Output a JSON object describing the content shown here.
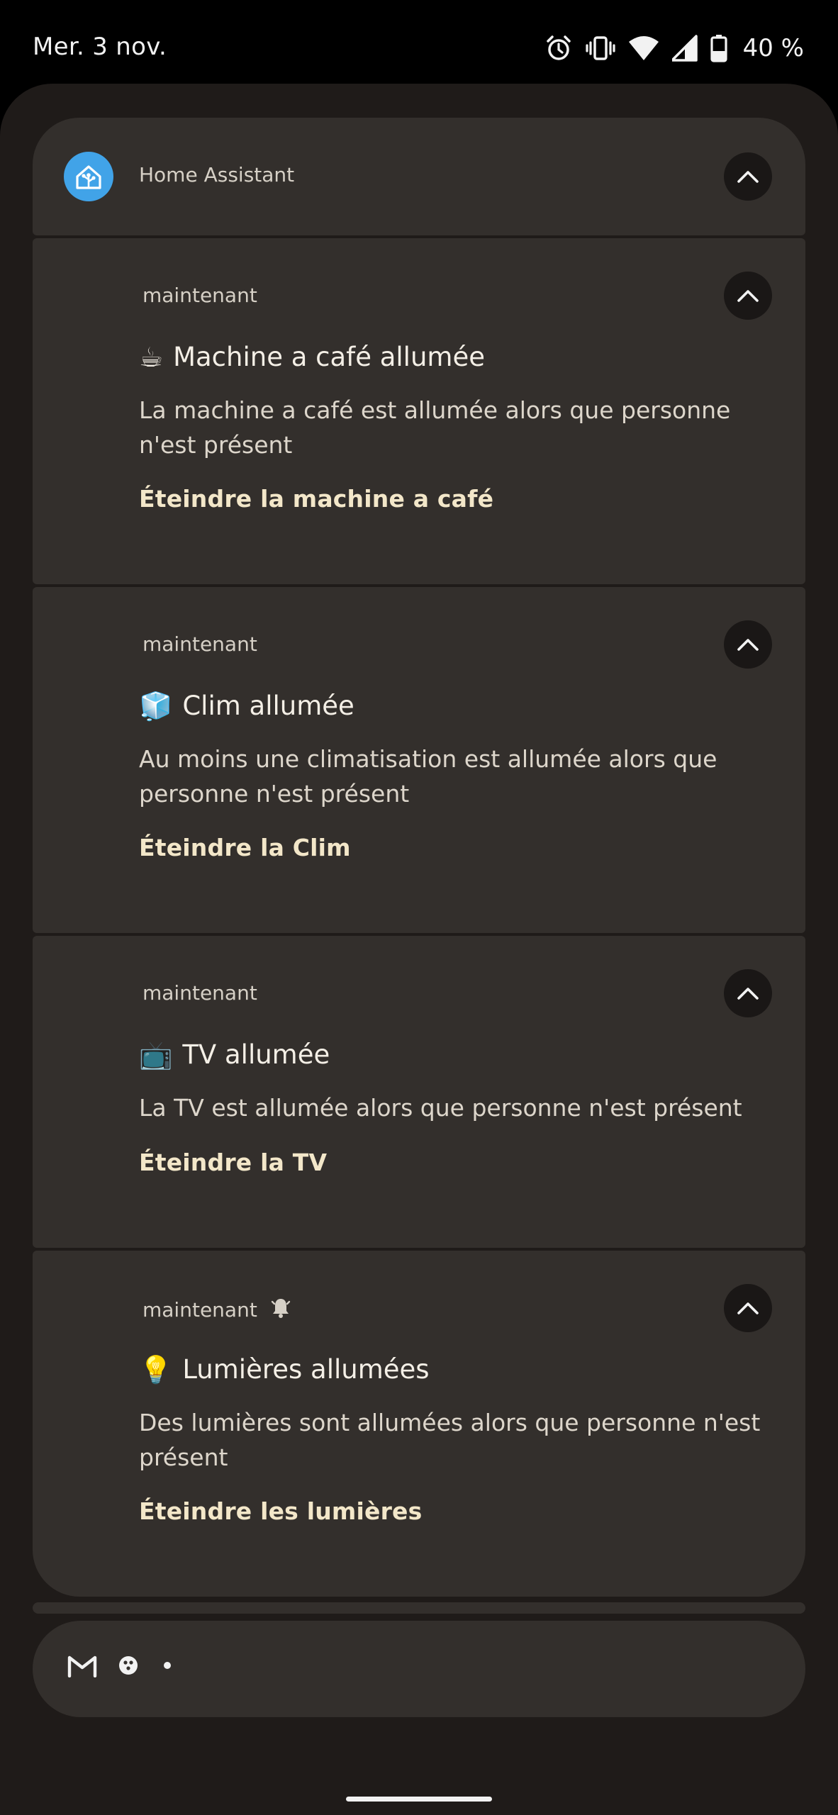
{
  "status_bar": {
    "date": "Mer. 3 nov.",
    "battery_percent": "40 %",
    "battery_level": 0.4,
    "icons": [
      "alarm-icon",
      "vibrate-icon",
      "wifi-icon",
      "cell-signal-icon",
      "battery-icon"
    ]
  },
  "group": {
    "app_name": "Home Assistant",
    "app_icon": "home-assistant-icon"
  },
  "notifications": [
    {
      "time": "maintenant",
      "emoji": "☕",
      "title": "Machine a café allumée",
      "body": "La machine a café est allumée alors que personne n'est présent",
      "action": "Éteindre la machine a café"
    },
    {
      "time": "maintenant",
      "emoji": "🧊",
      "title": "Clim allumée",
      "body": "Au moins une climatisation est allumée alors que personne n'est présent",
      "action": "Éteindre la Clim"
    },
    {
      "time": "maintenant",
      "emoji": "📺",
      "title": "TV allumée",
      "body": "La TV est allumée alors que personne n'est présent",
      "action": "Éteindre la TV"
    },
    {
      "time": "maintenant",
      "emoji": "💡",
      "title": "Lumières allumées",
      "body": "Des lumières sont allumées alors que personne n'est présent",
      "action": "Éteindre les lumières",
      "alerted_icon": "bell-icon"
    }
  ],
  "silent_row": {
    "icons": [
      "gmail-icon",
      "messaging-icon",
      "more-dot-icon"
    ]
  },
  "colors": {
    "card": "#332f2c",
    "shade": "#1f1b19",
    "app_icon": "#41a3e8",
    "action_text": "#f3e7c9"
  }
}
